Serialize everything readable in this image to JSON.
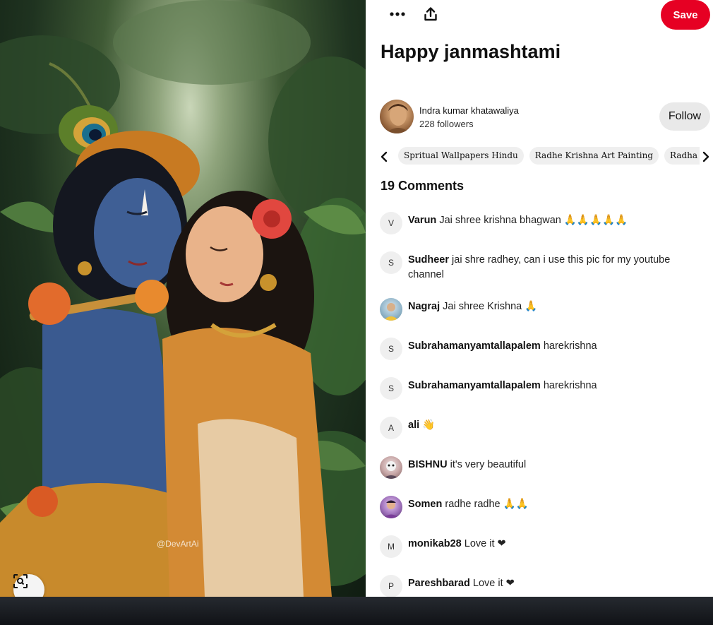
{
  "toolbar": {
    "more_icon": "more-horizontal-icon",
    "share_icon": "share-upload-icon",
    "save_label": "Save"
  },
  "image": {
    "watermark": "@DevArtAi",
    "lens_icon": "visual-search-icon"
  },
  "pin": {
    "title": "Happy janmashtami"
  },
  "creator": {
    "name": "Indra kumar khatawaliya",
    "followers": "228 followers",
    "follow_label": "Follow"
  },
  "tags": [
    "Spritual Wallpapers Hindu",
    "Radhe Krishna Art Painting",
    "Radha Krishna Images"
  ],
  "comments": {
    "title": "19 Comments",
    "items": [
      {
        "initial": "V",
        "author": "Varun",
        "text": "Jai shree krishna bhagwan 🙏🙏🙏🙏🙏"
      },
      {
        "initial": "S",
        "author": "Sudheer",
        "text": "jai shre radhey, can i use this pic for my youtube channel"
      },
      {
        "initial": "",
        "author": "Nagraj",
        "text": "Jai shree Krishna 🙏"
      },
      {
        "initial": "S",
        "author": "Subrahamanyamtallapalem",
        "text": "harekrishna"
      },
      {
        "initial": "S",
        "author": "Subrahamanyamtallapalem",
        "text": "harekrishna"
      },
      {
        "initial": "A",
        "author": "ali",
        "text": "👋"
      },
      {
        "initial": "",
        "author": "BISHNU",
        "text": "it's very beautiful"
      },
      {
        "initial": "",
        "author": "Somen",
        "text": "radhe radhe 🙏🙏"
      },
      {
        "initial": "M",
        "author": "monikab28",
        "text": "Love it ❤"
      },
      {
        "initial": "P",
        "author": "Pareshbarad",
        "text": "Love it ❤"
      }
    ]
  },
  "colors": {
    "save_red": "#e60023",
    "chip_grey": "#efefef",
    "follow_grey": "#e9e9e9"
  }
}
